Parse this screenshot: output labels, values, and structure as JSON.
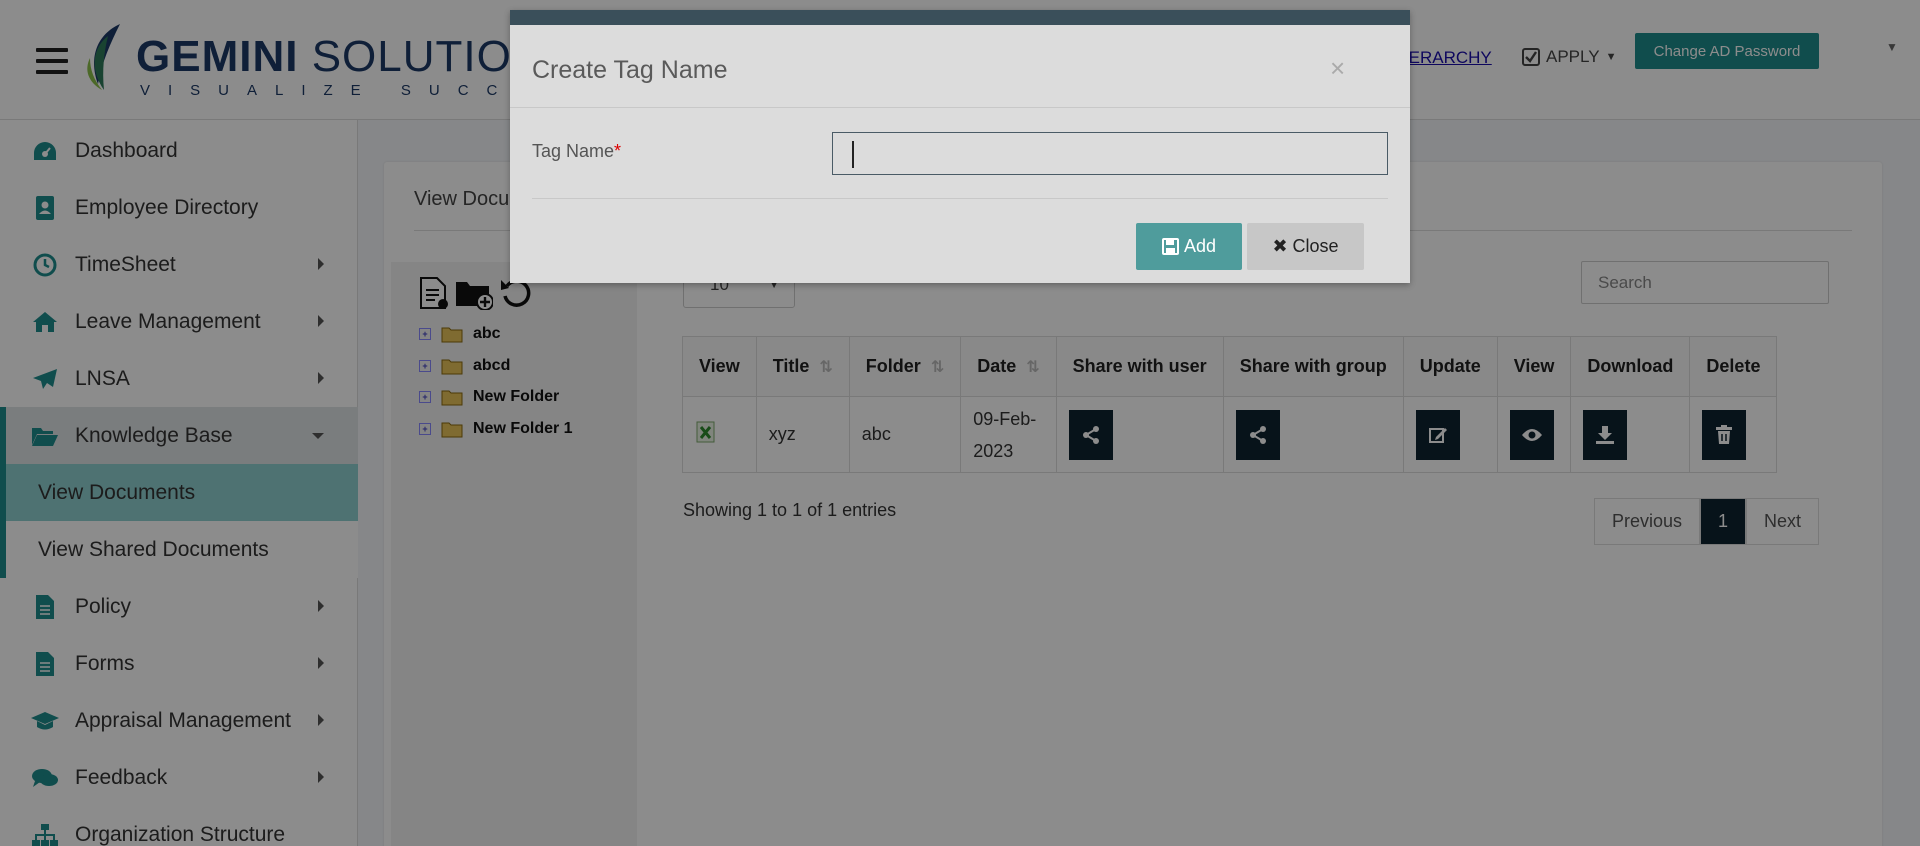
{
  "header": {
    "logo_main": "GEMINI",
    "logo_second": "SOLUTIONS",
    "logo_tagline": "VISUALIZE SUCCESS",
    "hierarchy_link": "EC DC HIERARCHY",
    "apply_label": "APPLY",
    "change_password": "Change AD Password"
  },
  "sidebar": {
    "items": [
      {
        "label": "Dashboard",
        "icon": "dashboard-icon"
      },
      {
        "label": "Employee Directory",
        "icon": "address-book-icon"
      },
      {
        "label": "TimeSheet",
        "icon": "clock-icon"
      },
      {
        "label": "Leave Management",
        "icon": "home-icon"
      },
      {
        "label": "LNSA",
        "icon": "paper-plane-icon"
      },
      {
        "label": "Knowledge Base",
        "icon": "folder-open-icon"
      },
      {
        "label": "View Documents"
      },
      {
        "label": "View Shared Documents"
      },
      {
        "label": "Policy",
        "icon": "file-icon"
      },
      {
        "label": "Forms",
        "icon": "file-icon"
      },
      {
        "label": "Appraisal Management",
        "icon": "graduation-cap-icon"
      },
      {
        "label": "Feedback",
        "icon": "comments-icon"
      },
      {
        "label": "Organization Structure",
        "icon": "sitemap-icon"
      }
    ]
  },
  "panel": {
    "title": "View Documents",
    "tree": [
      "abc",
      "abcd",
      "New Folder",
      "New Folder 1"
    ],
    "page_length": "10",
    "search_placeholder": "Search",
    "columns": [
      "View",
      "Title",
      "Folder",
      "Date",
      "Share with user",
      "Share with group",
      "Update",
      "View",
      "Download",
      "Delete"
    ],
    "rows": [
      {
        "title": "xyz",
        "folder": "abc",
        "date_line1": "09-Feb-",
        "date_line2": "2023"
      }
    ],
    "info": "Showing 1 to 1 of 1 entries",
    "pager": {
      "previous": "Previous",
      "current": "1",
      "next": "Next"
    }
  },
  "modal": {
    "title": "Create Tag Name",
    "close_x": "×",
    "field_label": "Tag Name",
    "required_mark": "*",
    "tag_value": "",
    "add_label": "Add",
    "close_label": "Close"
  },
  "colors": {
    "accent": "#1e8c8c",
    "modal_header": "#3a4f5a",
    "action_button": "#0e2330"
  }
}
